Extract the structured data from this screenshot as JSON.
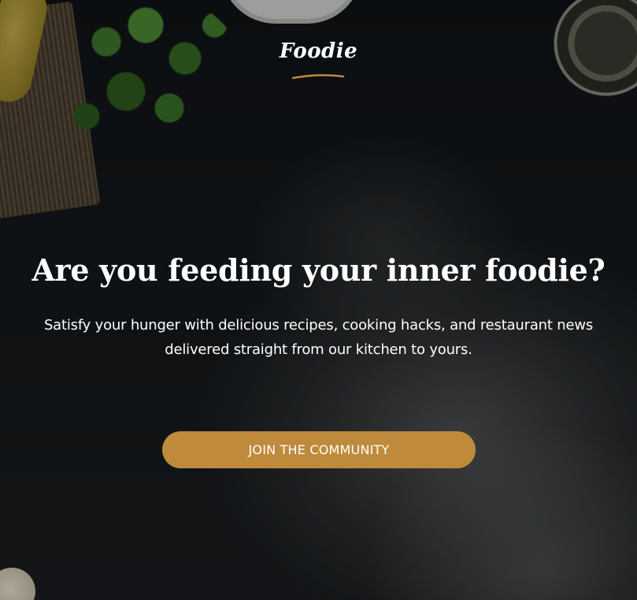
{
  "brand": {
    "logo_text": "Foodie",
    "accent_color": "#bf8a3c"
  },
  "hero": {
    "title": "Are you feeding your inner foodie?",
    "subtitle": "Satisfy your hunger with delicious recipes, cooking hacks, and restaurant news delivered straight from our kitchen to yours.",
    "cta_label": "JOIN THE COMMUNITY"
  },
  "background": {
    "description_icons": [
      "burlap-cloth",
      "pepper",
      "parsley",
      "plate",
      "glass-bowl",
      "flour",
      "garlic"
    ]
  }
}
